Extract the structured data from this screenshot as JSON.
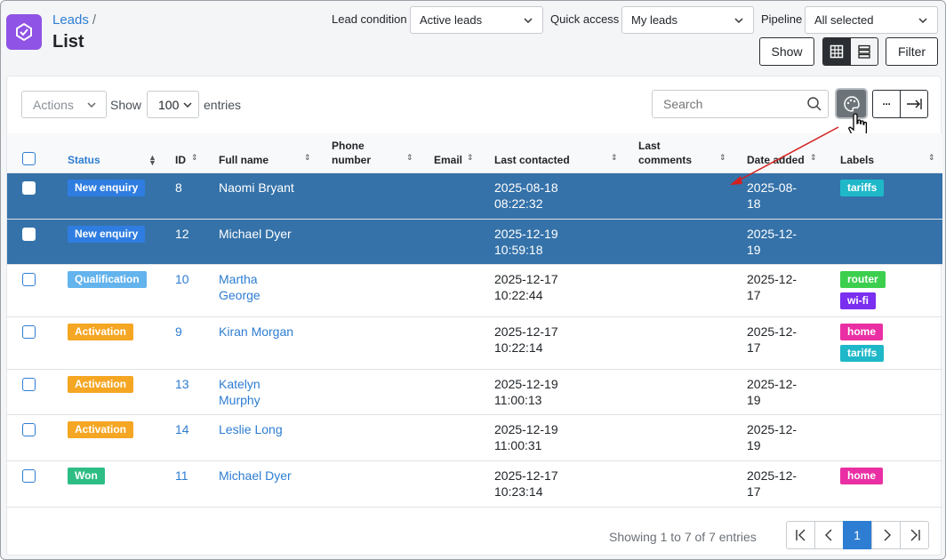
{
  "header": {
    "breadcrumb": "Leads",
    "breadcrumb_sep": "/",
    "title": "List",
    "filters": [
      {
        "label": "Lead condition",
        "value": "Active leads"
      },
      {
        "label": "Quick access",
        "value": "My leads"
      },
      {
        "label": "Pipeline",
        "value": "All selected"
      }
    ],
    "show_label": "Show",
    "filter_label": "Filter"
  },
  "toolbar": {
    "actions_label": "Actions",
    "show_prefix": "Show",
    "entries_value": "100",
    "entries_suffix": "entries",
    "search_placeholder": "Search",
    "more_label": "···"
  },
  "table": {
    "columns": [
      "Status",
      "ID",
      "Full name",
      "Phone number",
      "Email",
      "Last contacted",
      "Last comments",
      "Date added",
      "Labels"
    ],
    "columns_wrapped": {
      "phone": [
        "Phone",
        "number"
      ],
      "last_comments": [
        "Last",
        "comments"
      ]
    },
    "rows": [
      {
        "status": "New enquiry",
        "status_color": "#2f7de1",
        "id": "8",
        "name": [
          "Naomi Bryant"
        ],
        "last_contacted": [
          "2025-08-18",
          "08:22:32"
        ],
        "date_added": [
          "2025-08-",
          "18"
        ],
        "labels": [
          {
            "text": "tariffs",
            "color": "#1fb8c9"
          }
        ],
        "selected": true
      },
      {
        "status": "New enquiry",
        "status_color": "#2f7de1",
        "id": "12",
        "name": [
          "Michael Dyer"
        ],
        "last_contacted": [
          "2025-12-19",
          "10:59:18"
        ],
        "date_added": [
          "2025-12-",
          "19"
        ],
        "labels": [],
        "selected": true
      },
      {
        "status": "Qualification",
        "status_color": "#63b3ed",
        "id": "10",
        "name": [
          "Martha",
          "George"
        ],
        "last_contacted": [
          "2025-12-17",
          "10:22:44"
        ],
        "date_added": [
          "2025-12-",
          "17"
        ],
        "labels": [
          {
            "text": "router",
            "color": "#3ccf4e"
          },
          {
            "text": "wi-fi",
            "color": "#7b2ff0"
          }
        ],
        "selected": false
      },
      {
        "status": "Activation",
        "status_color": "#f5a623",
        "id": "9",
        "name": [
          "Kiran Morgan"
        ],
        "last_contacted": [
          "2025-12-17",
          "10:22:14"
        ],
        "date_added": [
          "2025-12-",
          "17"
        ],
        "labels": [
          {
            "text": "home",
            "color": "#ea2fa4"
          },
          {
            "text": "tariffs",
            "color": "#1fb8c9"
          }
        ],
        "selected": false
      },
      {
        "status": "Activation",
        "status_color": "#f5a623",
        "id": "13",
        "name": [
          "Katelyn",
          "Murphy"
        ],
        "last_contacted": [
          "2025-12-19",
          "11:00:13"
        ],
        "date_added": [
          "2025-12-",
          "19"
        ],
        "labels": [],
        "selected": false
      },
      {
        "status": "Activation",
        "status_color": "#f5a623",
        "id": "14",
        "name": [
          "Leslie Long"
        ],
        "last_contacted": [
          "2025-12-19",
          "11:00:31"
        ],
        "date_added": [
          "2025-12-",
          "19"
        ],
        "labels": [],
        "selected": false
      },
      {
        "status": "Won",
        "status_color": "#2ebd85",
        "id": "11",
        "name": [
          "Michael Dyer"
        ],
        "last_contacted": [
          "2025-12-17",
          "10:23:14"
        ],
        "date_added": [
          "2025-12-",
          "17"
        ],
        "labels": [
          {
            "text": "home",
            "color": "#ea2fa4"
          }
        ],
        "selected": false
      }
    ]
  },
  "footer": {
    "info": "Showing 1 to 7 of 7 entries",
    "current_page": "1"
  },
  "colors": {
    "accent": "#2d7dd2",
    "logo": "#8f53e6",
    "selected_row": "#3572a9"
  },
  "icons": [
    "handshake-icon",
    "chevron-down-icon",
    "grid-view-icon",
    "list-view-icon",
    "search-icon",
    "palette-icon",
    "more-icon",
    "expand-icon",
    "hand-cursor-icon",
    "sort-icon",
    "first-page-icon",
    "prev-page-icon",
    "next-page-icon",
    "last-page-icon"
  ]
}
